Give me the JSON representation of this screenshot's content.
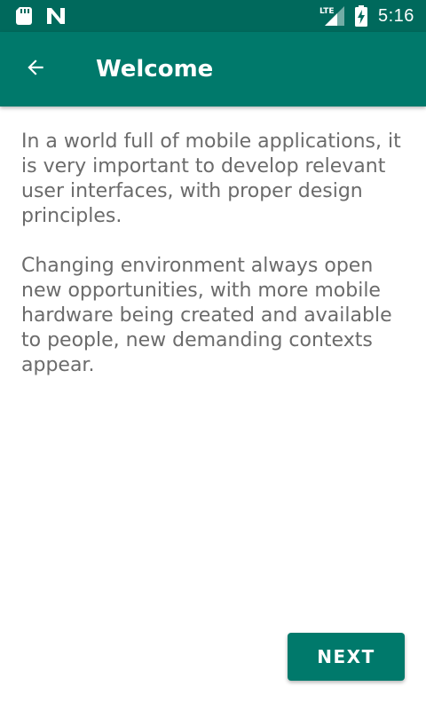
{
  "status_bar": {
    "time": "5:16",
    "network": "LTE",
    "icons": [
      "sd-card-icon",
      "n-icon",
      "lte-signal-icon",
      "battery-charging-icon"
    ]
  },
  "app_bar": {
    "back_icon": "arrow-back-icon",
    "title": "Welcome"
  },
  "content": {
    "paragraphs": [
      "In a world full of mobile applications, it is very important to develop relevant user interfaces, with proper design principles.",
      "Changing environment always open new opportunities, with more mobile hardware being created and available to people, new demanding contexts appear."
    ]
  },
  "actions": {
    "next_label": "NEXT"
  },
  "colors": {
    "status_bar": "#00695c",
    "app_bar": "#00796b",
    "text": "#6b6b6b",
    "button": "#00796b",
    "background": "#ffffff"
  }
}
